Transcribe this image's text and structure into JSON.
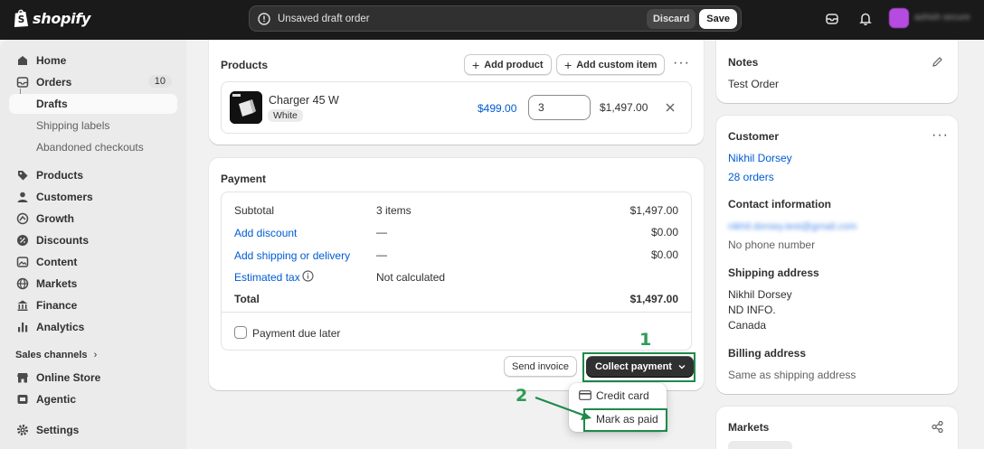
{
  "topbar": {
    "brand": "shopify",
    "draft_message": "Unsaved draft order",
    "discard_label": "Discard",
    "save_label": "Save",
    "store_name": "ashish secure"
  },
  "sidebar": {
    "home": "Home",
    "orders": "Orders",
    "orders_count": "10",
    "drafts": "Drafts",
    "shipping_labels": "Shipping labels",
    "abandoned_checkouts": "Abandoned checkouts",
    "products": "Products",
    "customers": "Customers",
    "growth": "Growth",
    "discounts": "Discounts",
    "content": "Content",
    "markets": "Markets",
    "finance": "Finance",
    "analytics": "Analytics",
    "sales_channels": "Sales channels",
    "online_store": "Online Store",
    "agentic": "Agentic",
    "settings": "Settings"
  },
  "products_card": {
    "title": "Products",
    "add_product": "Add product",
    "add_custom_item": "Add custom item",
    "item": {
      "name": "Charger 45 W",
      "variant": "White",
      "price": "$499.00",
      "quantity": "3",
      "total": "$1,497.00"
    }
  },
  "payment_card": {
    "title": "Payment",
    "rows": {
      "subtotal_label": "Subtotal",
      "subtotal_detail": "3 items",
      "subtotal_value": "$1,497.00",
      "discount_label": "Add discount",
      "discount_detail": "—",
      "discount_value": "$0.00",
      "shipping_label": "Add shipping or delivery",
      "shipping_detail": "—",
      "shipping_value": "$0.00",
      "tax_label": "Estimated tax",
      "tax_detail": "Not calculated",
      "total_label": "Total",
      "total_value": "$1,497.00"
    },
    "payment_due_later": "Payment due later",
    "send_invoice": "Send invoice",
    "collect_payment": "Collect payment",
    "menu": {
      "credit_card": "Credit card",
      "mark_as_paid": "Mark as paid"
    }
  },
  "annotations": {
    "step1": "1",
    "step2": "2",
    "highlight_color": "#1e8a4a"
  },
  "notes_card": {
    "title": "Notes",
    "text": "Test Order"
  },
  "customer_card": {
    "title": "Customer",
    "name": "Nikhil Dorsey",
    "orders": "28 orders",
    "contact_title": "Contact information",
    "email": "nikhil.dorsey.test@gmail.com",
    "phone": "No phone number",
    "shipping_title": "Shipping address",
    "shipping_line1": "Nikhil Dorsey",
    "shipping_line2": "ND INFO.",
    "shipping_line3": "Canada",
    "billing_title": "Billing address",
    "billing_text": "Same as shipping address"
  },
  "markets_card": {
    "title": "Markets"
  }
}
